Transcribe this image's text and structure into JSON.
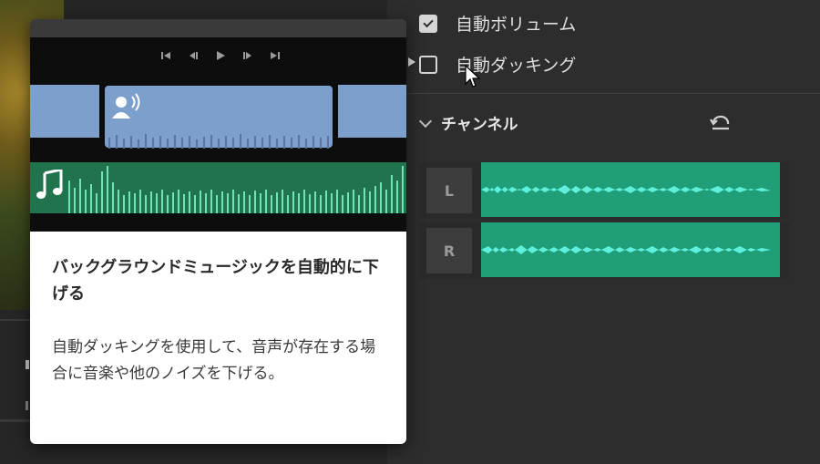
{
  "panel": {
    "options": [
      {
        "label": "自動ボリューム",
        "checked": true
      },
      {
        "label": "自動ダッキング",
        "checked": false
      }
    ],
    "channel_section": {
      "title": "チャンネル",
      "channels": [
        {
          "label": "L"
        },
        {
          "label": "R"
        }
      ]
    }
  },
  "tooltip": {
    "title": "バックグラウンドミュージックを自動的に下げる",
    "description": "自動ダッキングを使用して、音声が存在する場合に音楽や他のノイズを下げる。"
  },
  "colors": {
    "panel_bg": "#2d2d2d",
    "clip_blue": "#7d9fcb",
    "music_green": "#20734c",
    "channel_wave": "#1f9e78",
    "wave_highlight": "#5ff0dc"
  },
  "icons": [
    "checkbox-checked-icon",
    "checkbox-unchecked-icon",
    "chevron-down-icon",
    "reset-icon",
    "cursor-arrow-icon",
    "speaker-person-icon",
    "music-note-icon",
    "skip-start-icon",
    "step-back-icon",
    "play-icon",
    "step-forward-icon",
    "skip-end-icon"
  ]
}
